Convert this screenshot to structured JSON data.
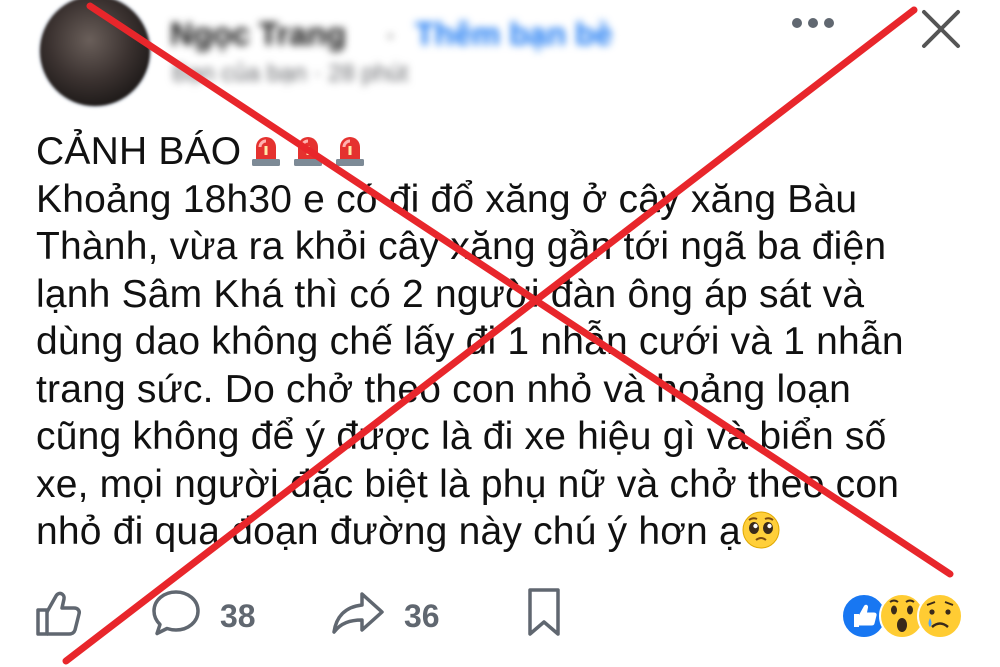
{
  "header": {
    "author_name": "Ngọc Trang",
    "separator": "·",
    "add_friend_label": "Thêm bạn bè",
    "meta": "Bạn của bạn · 28 phút"
  },
  "post": {
    "lines": [
      "CẢNH BÁO",
      "Khoảng 18h30 e có đi đổ xăng ở cây xăng Bàu",
      "Thành, vừa ra khỏi cây xăng gần tới ngã ba điện",
      "lạnh Sâm Khá thì có 2 người đàn ông áp sát và",
      "dùng dao không chế lấy đi 1 nhẫn cưới và 1 nhẫn",
      "trang sức. Do chở theo con nhỏ và hoảng loạn",
      "cũng không để ý được là đi xe hiệu gì và biển số",
      "xe, mọi người đặc biệt là phụ nữ và chở theo con",
      "nhỏ đi qua đoạn đường này chú ý hơn ạ"
    ]
  },
  "actions": {
    "comment_count": "38",
    "share_count": "36"
  },
  "icons": {
    "more": "more-dots-icon",
    "close": "close-icon",
    "like": "like-thumb-icon",
    "comment": "comment-bubble-icon",
    "share": "share-arrow-icon",
    "save": "bookmark-icon",
    "siren": "police-light-icon",
    "pleading": "pleading-face-icon"
  },
  "colors": {
    "cross": "#e8262b",
    "accent": "#1877f2",
    "text": "#111111",
    "muted": "#606770"
  }
}
